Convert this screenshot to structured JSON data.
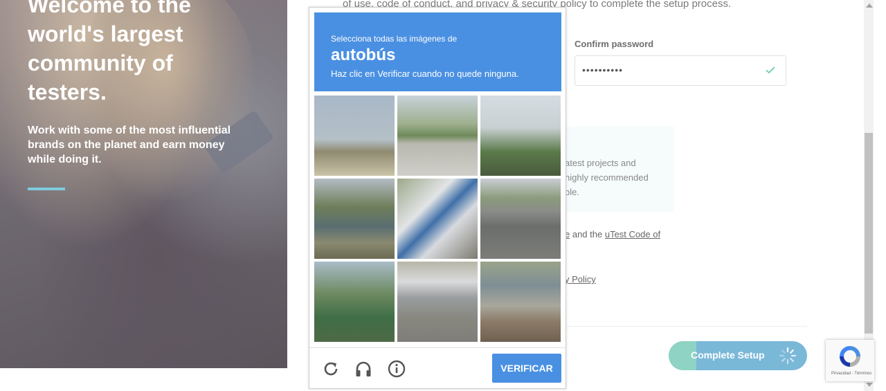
{
  "hero": {
    "title": "Welcome to the world's largest community of testers.",
    "subtitle": "Work with some of the most influential brands on the planet and earn money while doing it."
  },
  "form": {
    "top_text": "of use, code of conduct, and privacy & security policy to complete the setup process.",
    "confirm_password_label": "Confirm password",
    "confirm_password_value": "••••••••••",
    "info_text": "atest projects and highly recommended ble.",
    "terms_prefix": "e",
    "terms_and": " and the ",
    "terms_link": "uTest Code of",
    "terms_link_cont": "",
    "privacy_link": "y Policy",
    "complete_button": "Complete Setup",
    "complete_progress": 0.2
  },
  "captcha": {
    "instruction_small": "Selecciona todas las imágenes de",
    "target_word": "autobús",
    "hint": "Haz clic en Verificar cuando no quede ninguna.",
    "verify_button": "VERIFICAR",
    "icons": [
      "reload-icon",
      "audio-icon",
      "info-icon"
    ],
    "header_color": "#4a90e2"
  },
  "recaptcha_badge": {
    "text": "Privacidad - Términos"
  },
  "colors": {
    "accent_blue": "#4a90e2",
    "hero_line": "#7ecbe0",
    "complete_button": "#7ab8d8",
    "complete_fill": "#8fd3c4",
    "check_green": "#5ec9a0"
  }
}
